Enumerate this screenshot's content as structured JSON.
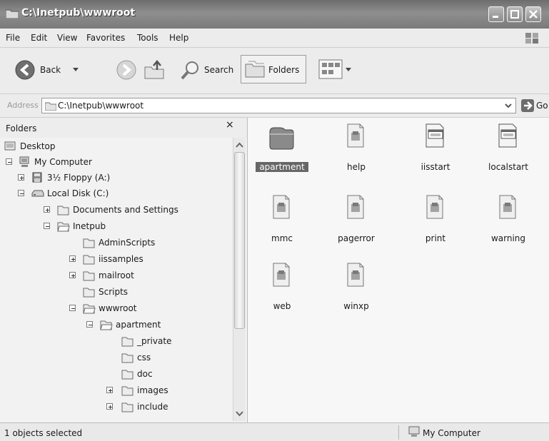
{
  "window": {
    "title": "C:\\Inetpub\\wwwroot",
    "controls": [
      "minimize-icon",
      "maximize-icon",
      "close-icon"
    ]
  },
  "menu": [
    "File",
    "Edit",
    "View",
    "Favorites",
    "Tools",
    "Help"
  ],
  "toolbar": {
    "back_label": "Back",
    "search_label": "Search",
    "folders_label": "Folders"
  },
  "address": {
    "label": "Address",
    "value": "C:\\Inetpub\\wwwroot",
    "go_label": "Go"
  },
  "folders_pane": {
    "title": "Folders",
    "close_glyph": "×",
    "tree": [
      {
        "label": "Desktop",
        "icon": "desktop-icon",
        "expander": ""
      },
      {
        "label": "My Computer",
        "icon": "my-computer-icon",
        "expander": "minus"
      },
      {
        "label": "3½ Floppy (A:)",
        "icon": "floppy-icon",
        "expander": "plus"
      },
      {
        "label": "Local Disk (C:)",
        "icon": "local-disk-icon",
        "expander": "minus"
      },
      {
        "label": "Documents and Settings",
        "icon": "folder-icon",
        "expander": "plus"
      },
      {
        "label": "Inetpub",
        "icon": "folder-open-icon",
        "expander": "minus"
      },
      {
        "label": "AdminScripts",
        "icon": "folder-icon",
        "expander": ""
      },
      {
        "label": "iissamples",
        "icon": "folder-icon",
        "expander": "plus"
      },
      {
        "label": "mailroot",
        "icon": "folder-icon",
        "expander": "plus"
      },
      {
        "label": "Scripts",
        "icon": "folder-icon",
        "expander": ""
      },
      {
        "label": "wwwroot",
        "icon": "folder-open-icon",
        "expander": "minus"
      },
      {
        "label": "apartment",
        "icon": "folder-open-icon",
        "expander": "minus"
      },
      {
        "label": "_private",
        "icon": "folder-icon",
        "expander": ""
      },
      {
        "label": "css",
        "icon": "folder-icon",
        "expander": ""
      },
      {
        "label": "doc",
        "icon": "folder-icon",
        "expander": ""
      },
      {
        "label": "images",
        "icon": "folder-icon",
        "expander": "plus"
      },
      {
        "label": "include",
        "icon": "folder-icon",
        "expander": "plus"
      }
    ]
  },
  "content": {
    "items": [
      {
        "label": "apartment",
        "icon": "folder-icon",
        "selected": true
      },
      {
        "label": "help",
        "icon": "html-file-icon",
        "selected": false
      },
      {
        "label": "iisstart",
        "icon": "asp-file-icon",
        "selected": false
      },
      {
        "label": "localstart",
        "icon": "asp-file-icon",
        "selected": false
      },
      {
        "label": "mmc",
        "icon": "html-file-icon",
        "selected": false
      },
      {
        "label": "pagerror",
        "icon": "html-file-icon",
        "selected": false
      },
      {
        "label": "print",
        "icon": "html-file-icon",
        "selected": false
      },
      {
        "label": "warning",
        "icon": "html-file-icon",
        "selected": false
      },
      {
        "label": "web",
        "icon": "html-file-icon",
        "selected": false
      },
      {
        "label": "winxp",
        "icon": "html-file-icon",
        "selected": false
      }
    ]
  },
  "status": {
    "text": "1 objects selected",
    "zone": "My Computer"
  }
}
